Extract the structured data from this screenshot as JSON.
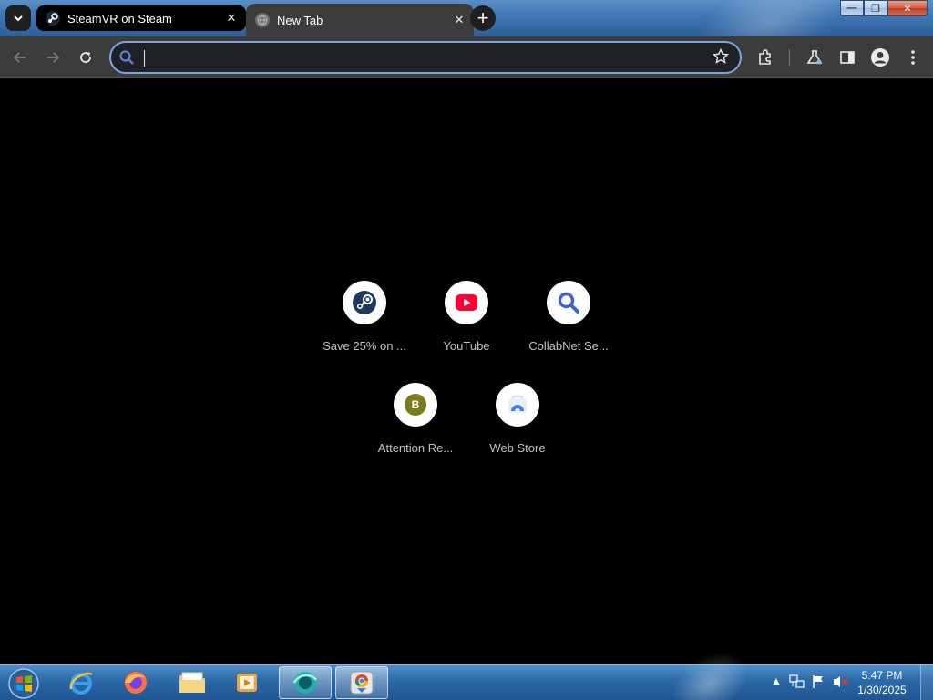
{
  "browser": {
    "tabs": [
      {
        "label": "SteamVR on Steam",
        "close": "✕"
      },
      {
        "label": "New Tab",
        "close": "✕"
      }
    ],
    "new_tab": "+",
    "window_controls": {
      "minimize": "—",
      "maximize": "❐",
      "close": "✕"
    }
  },
  "toolbar": {
    "omnibox_value": "",
    "omnibox_placeholder": "",
    "icons": [
      "back-icon",
      "forward-icon",
      "reload-icon",
      "search-icon",
      "star-icon",
      "extensions-icon",
      "labs-icon",
      "side-panel-icon",
      "profile-icon",
      "menu-icon"
    ]
  },
  "shortcuts": [
    {
      "label": "Save 25% on ...",
      "icon": "steam-icon"
    },
    {
      "label": "YouTube",
      "icon": "youtube-icon"
    },
    {
      "label": "CollabNet Se...",
      "icon": "magnifier-icon"
    },
    {
      "label": "Attention Re...",
      "icon": "letter-b-icon",
      "letter": "B"
    },
    {
      "label": "Web Store",
      "icon": "webstore-icon"
    }
  ],
  "taskbar": {
    "apps": [
      "start-orb",
      "internet-explorer-icon",
      "firefox-icon",
      "file-explorer-icon",
      "media-player-icon",
      "app-icon",
      "chrome-installer-icon"
    ],
    "tray_arrow": "▲",
    "clock": {
      "time": "5:47 PM",
      "date": "1/30/2025"
    }
  },
  "colors": {
    "accent": "#7aa6e8",
    "tab_active": "#3c3c3c",
    "youtube_red": "#ff0033",
    "steam_blue": "#1b2838"
  }
}
